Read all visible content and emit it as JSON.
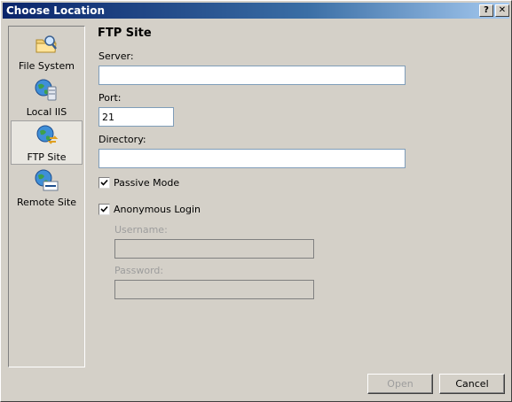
{
  "window": {
    "title": "Choose Location",
    "help_glyph": "?",
    "close_glyph": "✕",
    "title_bar_color": "#0a246a"
  },
  "sidebar": {
    "items": [
      {
        "label": "File System",
        "icon": "folder-search-icon",
        "selected": false
      },
      {
        "label": "Local IIS",
        "icon": "globe-server-icon",
        "selected": false
      },
      {
        "label": "FTP Site",
        "icon": "globe-ftp-icon",
        "selected": true
      },
      {
        "label": "Remote Site",
        "icon": "globe-http-icon",
        "selected": false
      }
    ]
  },
  "form": {
    "heading": "FTP Site",
    "server": {
      "label": "Server:",
      "value": ""
    },
    "port": {
      "label": "Port:",
      "value": "21"
    },
    "directory": {
      "label": "Directory:",
      "value": ""
    },
    "passive_mode": {
      "label": "Passive Mode",
      "checked": true
    },
    "anonymous_login": {
      "label": "Anonymous Login",
      "checked": true
    },
    "username": {
      "label": "Username:",
      "value": "",
      "disabled": true
    },
    "password": {
      "label": "Password:",
      "value": "",
      "disabled": true
    }
  },
  "buttons": {
    "open": "Open",
    "cancel": "Cancel"
  }
}
